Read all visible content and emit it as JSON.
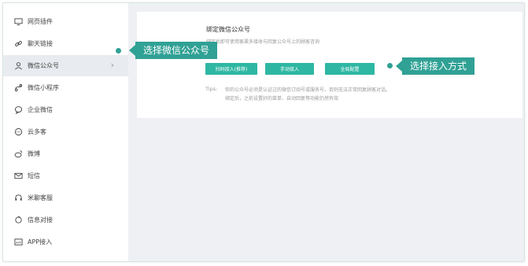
{
  "sidebar": {
    "items": [
      {
        "label": "网页插件",
        "icon": "monitor-icon"
      },
      {
        "label": "聊天链接",
        "icon": "link-icon"
      },
      {
        "label": "微信公众号",
        "icon": "user-icon"
      },
      {
        "label": "微信小程序",
        "icon": "mini-program-icon"
      },
      {
        "label": "企业微信",
        "icon": "chat-bubble-icon"
      },
      {
        "label": "云多客",
        "icon": "cloud-chat-icon"
      },
      {
        "label": "微博",
        "icon": "weibo-icon"
      },
      {
        "label": "短信",
        "icon": "mail-icon"
      },
      {
        "label": "米聊客服",
        "icon": "headset-icon"
      },
      {
        "label": "信息对接",
        "icon": "sync-icon"
      },
      {
        "label": "APP接入",
        "icon": "app-icon"
      }
    ],
    "active_index": 2,
    "chevron": "›"
  },
  "panel": {
    "title": "绑定微信公众号",
    "description": "绑定后即可使用客渠多接收与回复公众号上的顾客咨询",
    "buttons": {
      "scan": "扫码接入(推荐)",
      "manual": "手动接入",
      "global": "全局配置"
    },
    "tips_label": "Tips:",
    "tips": [
      "你的公众号必须是认证过的微信订阅号或服务号，否则无法正常回复顾客对话。",
      "绑定后，之前设置好的菜单、自动回复等功能仍然有效"
    ]
  },
  "annotations": {
    "select_account": "选择微信公众号",
    "select_method": "选择接入方式"
  },
  "colors": {
    "accent": "#2eb7a3",
    "callout": "#30a195",
    "active_bg": "#e8ebef",
    "content_bg": "#eef0f3"
  }
}
